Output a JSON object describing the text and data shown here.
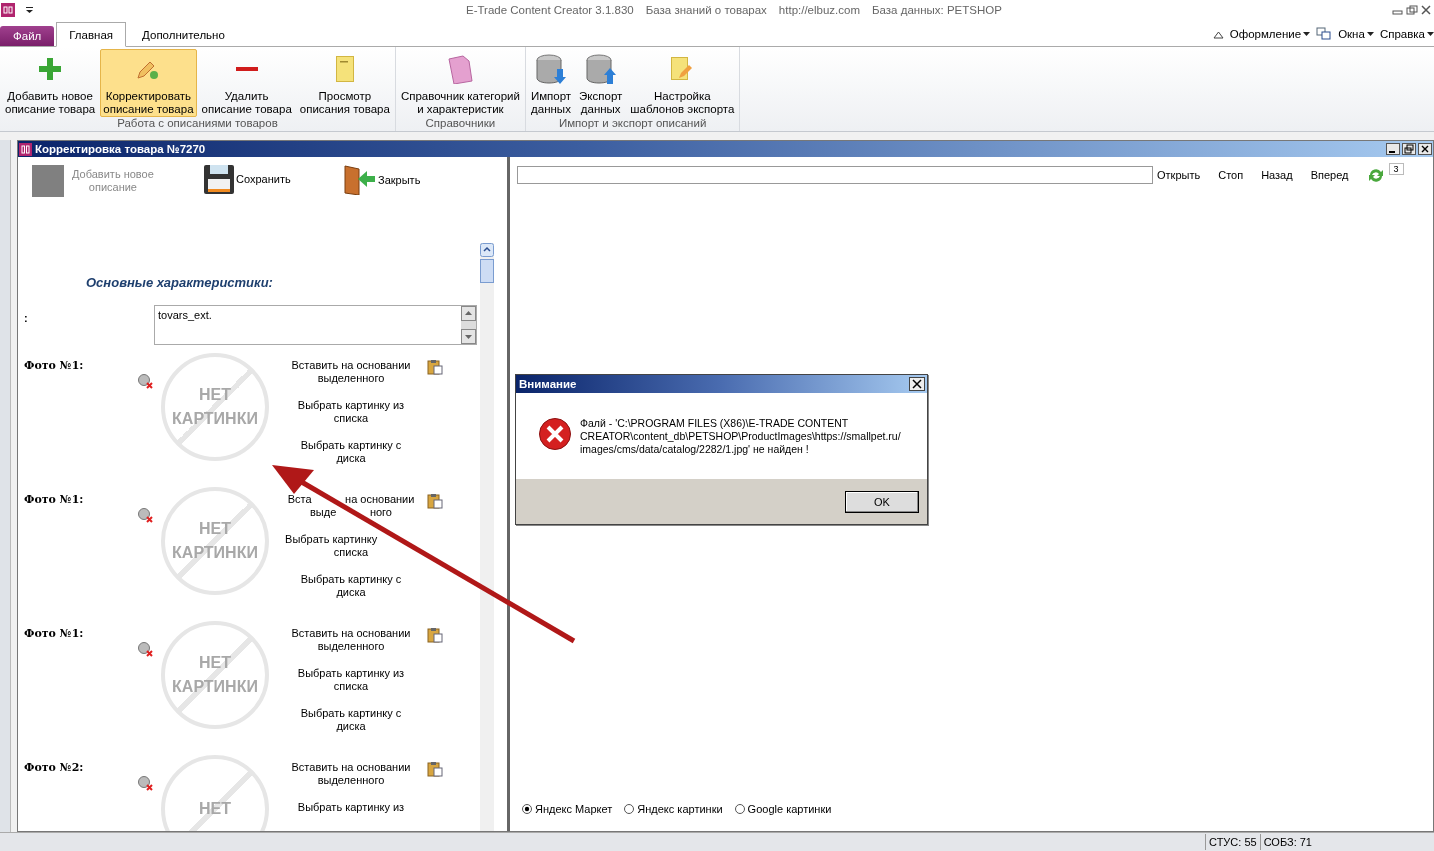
{
  "window": {
    "title_items": [
      "E-Trade Content Creator 3.1.830",
      "База знаний о товарах",
      "http://elbuz.com",
      "База данных: PETSHOP"
    ]
  },
  "tabs": [
    {
      "label": "Файл",
      "kind": "file",
      "selected": false
    },
    {
      "label": "Главная",
      "kind": "tab",
      "selected": true
    },
    {
      "label": "Дополнительно",
      "kind": "tab",
      "selected": false
    }
  ],
  "menu_right": [
    "Оформление",
    "Окна",
    "Справка"
  ],
  "ribbon": {
    "groups": [
      {
        "label": "Работа с описаниями товаров",
        "buttons": [
          {
            "label": "Добавить новое\nописание товара",
            "selected": false
          },
          {
            "label": "Корректировать\nописание товара",
            "selected": true
          },
          {
            "label": "Удалить\nописание товара",
            "selected": false
          },
          {
            "label": "Просмотр\nописания товара",
            "selected": false
          }
        ]
      },
      {
        "label": "Справочники",
        "buttons": [
          {
            "label": "Справочник категорий\nи характеристик",
            "selected": false
          }
        ]
      },
      {
        "label": "Импорт и экспорт описаний",
        "buttons": [
          {
            "label": "Импорт\nданных",
            "selected": false
          },
          {
            "label": "Экспорт\nданных",
            "selected": false
          },
          {
            "label": "Настройка\nшаблонов экспорта",
            "selected": false
          }
        ]
      }
    ]
  },
  "editor": {
    "title": "Корректировка товара №7270",
    "toolbar": [
      {
        "label": "Добавить новое\nописание",
        "disabled": true
      },
      {
        "label": "Сохранить",
        "disabled": false
      },
      {
        "label": "Закрыть",
        "disabled": false
      }
    ],
    "section_title": "Основные характеристики:",
    "field": {
      "label": ":",
      "value": "tovars_ext."
    },
    "photos": [
      {
        "label": "Фото №1:",
        "no_image": "НЕТ\nКАРТИНКИ",
        "actions": [
          "Вставить на основании\nвыделенного",
          "Выбрать картинку из\nсписка",
          "Выбрать картинку с\nдиска"
        ]
      },
      {
        "label": "Фото №1:",
        "no_image": "НЕТ\nКАРТИНКИ",
        "actions": [
          "Вста           на основании\nвыде           ного",
          "Выбрать картинку             \nсписка",
          "Выбрать картинку с\nдиска"
        ]
      },
      {
        "label": "Фото №1:",
        "no_image": "НЕТ\nКАРТИНКИ",
        "actions": [
          "Вставить на основании\nвыделенного",
          "Выбрать картинку из\nсписка",
          "Выбрать картинку с\nдиска"
        ]
      },
      {
        "label": "Фото №2:",
        "no_image": "НЕТ",
        "actions": [
          "Вставить на основании\nвыделенного",
          "Выбрать картинку из"
        ]
      }
    ]
  },
  "browser": {
    "buttons": [
      "Открыть",
      "Стоп",
      "Назад",
      "Вперед"
    ],
    "counter": "3",
    "search_engines": [
      {
        "label": "Яндекс Маркет",
        "selected": true
      },
      {
        "label": "Яндекс картинки",
        "selected": false
      },
      {
        "label": "Google картинки",
        "selected": false
      }
    ]
  },
  "dialog": {
    "title": "Внимание",
    "message": "Фалй - 'C:\\PROGRAM FILES (X86)\\E-TRADE CONTENT CREATOR\\content_db\\PETSHOP\\ProductImages\\https://smallpet.ru/images/cms/data/catalog/2282/1.jpg' не найден !",
    "button": "OK"
  },
  "status_bar": [
    "СТУС: 55",
    "СОБЗ: 71"
  ]
}
